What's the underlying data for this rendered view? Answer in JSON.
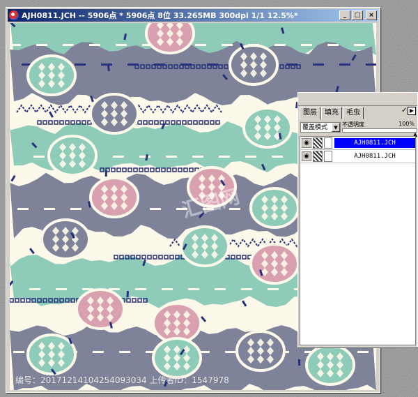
{
  "window": {
    "title": "AJH0811.JCH -- 5906点 * 5906点 8位  33.265MB 300dpi 1/1  12.5%*",
    "min_glyph": "_",
    "max_glyph": "□",
    "close_glyph": "×"
  },
  "colors": {
    "navy": "#7f8399",
    "mint": "#8ecbb9",
    "cream": "#fdf9ea",
    "pink": "#d9a0b0",
    "dark": "#27307a"
  },
  "panel": {
    "tabs": [
      "图层",
      "填充",
      "毛虫"
    ],
    "mode": "覆盖模式",
    "opacity_label": "不透明度",
    "opacity_value": "100%",
    "layers": [
      {
        "name": "AJH0811.JCH",
        "selected": true
      },
      {
        "name": "AJH0811.JCH",
        "selected": false
      }
    ],
    "check_glyph": "✓",
    "arrow_glyph": "▶",
    "eye_glyph": "◉"
  },
  "watermark": {
    "text": "编号：20171214104254093034 上传者ID：1547978"
  }
}
